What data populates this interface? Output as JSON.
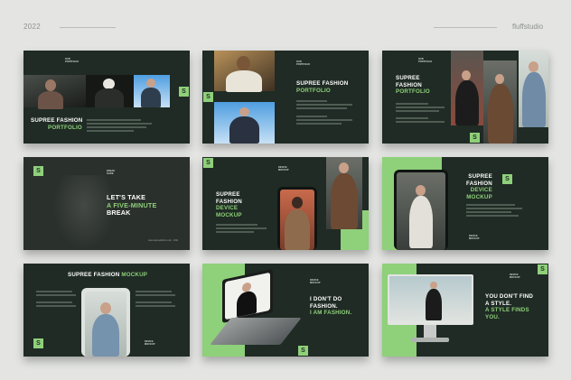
{
  "header": {
    "year": "2022",
    "brand": "fluffstudio"
  },
  "slides": {
    "s1": {
      "tag_a": "OUR",
      "tag_b": "PORTFOLIO",
      "title_a": "SUPREE FASHION",
      "title_b": "PORTFOLIO",
      "logo": "S"
    },
    "s2": {
      "tag_a": "OUR",
      "tag_b": "PORTFOLIO",
      "title_a": "SUPREE FASHION",
      "title_b": "PORTFOLIO",
      "logo": "S"
    },
    "s3": {
      "tag_a": "OUR",
      "tag_b": "PORTFOLIO",
      "title_a": "SUPREE",
      "title_b": "FASHION",
      "title_c": "PORTFOLIO",
      "logo": "S"
    },
    "s4": {
      "tag_a": "BREAK",
      "tag_b": "SLIDE",
      "title_a": "LET'S TAKE",
      "title_b": "A FIVE-MINUTE",
      "title_c": "BREAK",
      "footer": "www.supreefashion.com · 2021",
      "logo": "S"
    },
    "s5": {
      "tag_a": "DEVICE",
      "tag_b": "MOCKUP",
      "title_a": "SUPREE",
      "title_b": "FASHION",
      "title_c": "DEVICE",
      "title_d": "MOCKUP",
      "logo": "S"
    },
    "s6": {
      "tag_a": "DEVICE",
      "tag_b": "MOCKUP",
      "title_a": "SUPREE",
      "title_b": "FASHION",
      "title_c": "DEVICE",
      "title_d": "MOCKUP",
      "logo": "S"
    },
    "s7": {
      "title_a": "SUPREE FASHION",
      "title_b": "MOCKUP",
      "tag_a": "DEVICE",
      "tag_b": "MOCKUP",
      "logo": "S"
    },
    "s8": {
      "tag_a": "DEVICE",
      "tag_b": "MOCKUP",
      "title_a": "I DON'T DO",
      "title_b": "FASHION.",
      "title_c": "I AM FASHION.",
      "logo": "S"
    },
    "s9": {
      "tag_a": "DEVICE",
      "tag_b": "MOCKUP",
      "title_a": "YOU DON'T FIND",
      "title_b": "A STYLE.",
      "title_c": "A STYLE FINDS",
      "title_d": "YOU.",
      "logo": "S"
    }
  },
  "colors": {
    "background": "#e4e5e3",
    "slide": "#1f2b24",
    "accent": "#8fd07a"
  },
  "icons": [
    "s-logo-icon",
    "phone-mockup-icon",
    "laptop-mockup-icon",
    "monitor-mockup-icon"
  ]
}
